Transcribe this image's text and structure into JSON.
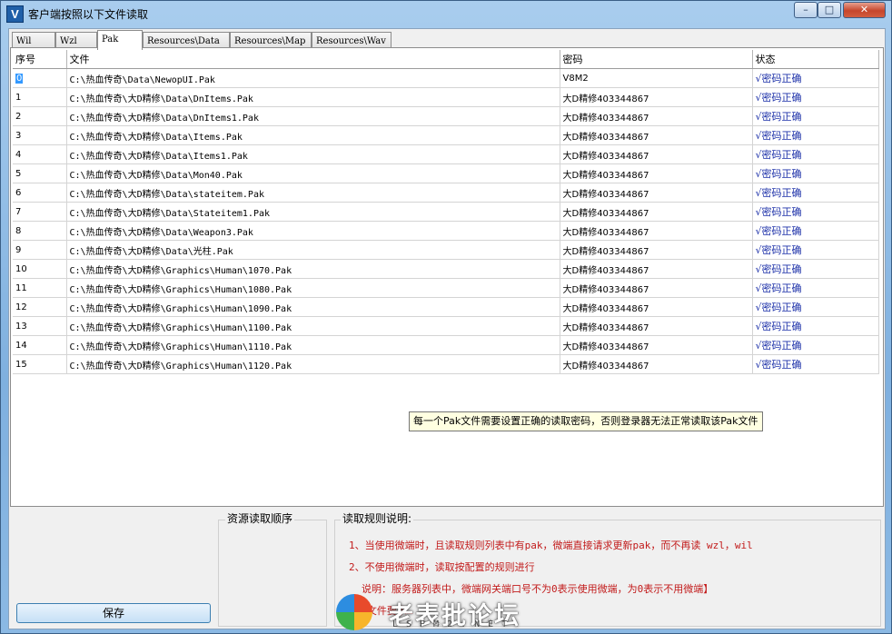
{
  "window": {
    "title": "客户端按照以下文件读取",
    "icon_letter": "V",
    "min_glyph": "–",
    "max_glyph": "□",
    "close_glyph": "✕"
  },
  "tabs": [
    {
      "label": "Wil",
      "active": false
    },
    {
      "label": "Wzl",
      "active": false
    },
    {
      "label": "Pak",
      "active": true
    },
    {
      "label": "Resources\\Data",
      "active": false
    },
    {
      "label": "Resources\\Map",
      "active": false
    },
    {
      "label": "Resources\\Wav",
      "active": false
    }
  ],
  "table": {
    "columns": [
      "序号",
      "文件",
      "密码",
      "状态"
    ],
    "rows": [
      {
        "idx": "0",
        "file": "C:\\热血传奇\\Data\\NewopUI.Pak",
        "password": "V8M2",
        "status": "√密码正确"
      },
      {
        "idx": "1",
        "file": "C:\\热血传奇\\大D精修\\Data\\DnItems.Pak",
        "password": "大D精修403344867",
        "status": "√密码正确"
      },
      {
        "idx": "2",
        "file": "C:\\热血传奇\\大D精修\\Data\\DnItems1.Pak",
        "password": "大D精修403344867",
        "status": "√密码正确"
      },
      {
        "idx": "3",
        "file": "C:\\热血传奇\\大D精修\\Data\\Items.Pak",
        "password": "大D精修403344867",
        "status": "√密码正确"
      },
      {
        "idx": "4",
        "file": "C:\\热血传奇\\大D精修\\Data\\Items1.Pak",
        "password": "大D精修403344867",
        "status": "√密码正确"
      },
      {
        "idx": "5",
        "file": "C:\\热血传奇\\大D精修\\Data\\Mon40.Pak",
        "password": "大D精修403344867",
        "status": "√密码正确"
      },
      {
        "idx": "6",
        "file": "C:\\热血传奇\\大D精修\\Data\\stateitem.Pak",
        "password": "大D精修403344867",
        "status": "√密码正确"
      },
      {
        "idx": "7",
        "file": "C:\\热血传奇\\大D精修\\Data\\Stateitem1.Pak",
        "password": "大D精修403344867",
        "status": "√密码正确"
      },
      {
        "idx": "8",
        "file": "C:\\热血传奇\\大D精修\\Data\\Weapon3.Pak",
        "password": "大D精修403344867",
        "status": "√密码正确"
      },
      {
        "idx": "9",
        "file": "C:\\热血传奇\\大D精修\\Data\\光柱.Pak",
        "password": "大D精修403344867",
        "status": "√密码正确"
      },
      {
        "idx": "10",
        "file": "C:\\热血传奇\\大D精修\\Graphics\\Human\\1070.Pak",
        "password": "大D精修403344867",
        "status": "√密码正确"
      },
      {
        "idx": "11",
        "file": "C:\\热血传奇\\大D精修\\Graphics\\Human\\1080.Pak",
        "password": "大D精修403344867",
        "status": "√密码正确"
      },
      {
        "idx": "12",
        "file": "C:\\热血传奇\\大D精修\\Graphics\\Human\\1090.Pak",
        "password": "大D精修403344867",
        "status": "√密码正确"
      },
      {
        "idx": "13",
        "file": "C:\\热血传奇\\大D精修\\Graphics\\Human\\1100.Pak",
        "password": "大D精修403344867",
        "status": "√密码正确"
      },
      {
        "idx": "14",
        "file": "C:\\热血传奇\\大D精修\\Graphics\\Human\\1110.Pak",
        "password": "大D精修403344867",
        "status": "√密码正确"
      },
      {
        "idx": "15",
        "file": "C:\\热血传奇\\大D精修\\Graphics\\Human\\1120.Pak",
        "password": "大D精修403344867",
        "status": "√密码正确"
      }
    ]
  },
  "tooltip": "每一个Pak文件需要设置正确的读取密码，否则登录器无法正常读取该Pak文件",
  "bottom": {
    "save_label": "保存",
    "order_label": "资源读取顺序",
    "rules_label": "读取规则说明:",
    "rules": [
      "1、当使用微端时，且读取规则列表中有pak，微端直接请求更新pak，而不再读 wzl，wil",
      "2、不使用微端时，读取按配置的规则进行",
      "说明：服务器列表中，微端网关端口号不为0表示使用微端，为0表示不用微端】",
      "Pak文件要求…"
    ]
  },
  "watermark": {
    "text": "老表批论坛",
    "sub": "LSPM2.NET"
  }
}
